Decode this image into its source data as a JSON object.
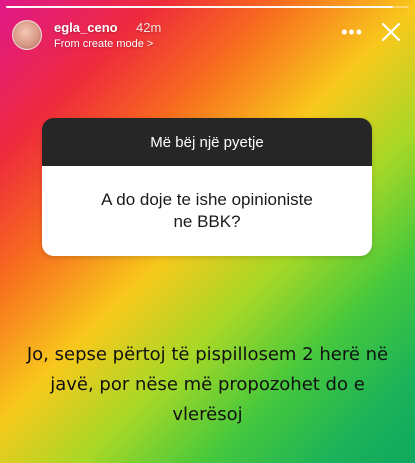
{
  "story": {
    "progress": 0.96
  },
  "header": {
    "username": "egla_ceno",
    "time": "42m",
    "subtitle": "From create mode >",
    "icons": [
      "more-icon",
      "close-icon"
    ]
  },
  "question_card": {
    "title": "Më bëj një pyetje",
    "question": "A do doje te ishe opinioniste ne BBK?"
  },
  "answer": {
    "text": "Jo, sepse përtoj të pispillosem 2 herë në javë, por nëse më propozohet do e vlerësoj"
  },
  "colors": {
    "card_header_bg": "#262626",
    "card_body_bg": "#ffffff",
    "text_light": "#ffffff",
    "text_dark": "#111111"
  }
}
